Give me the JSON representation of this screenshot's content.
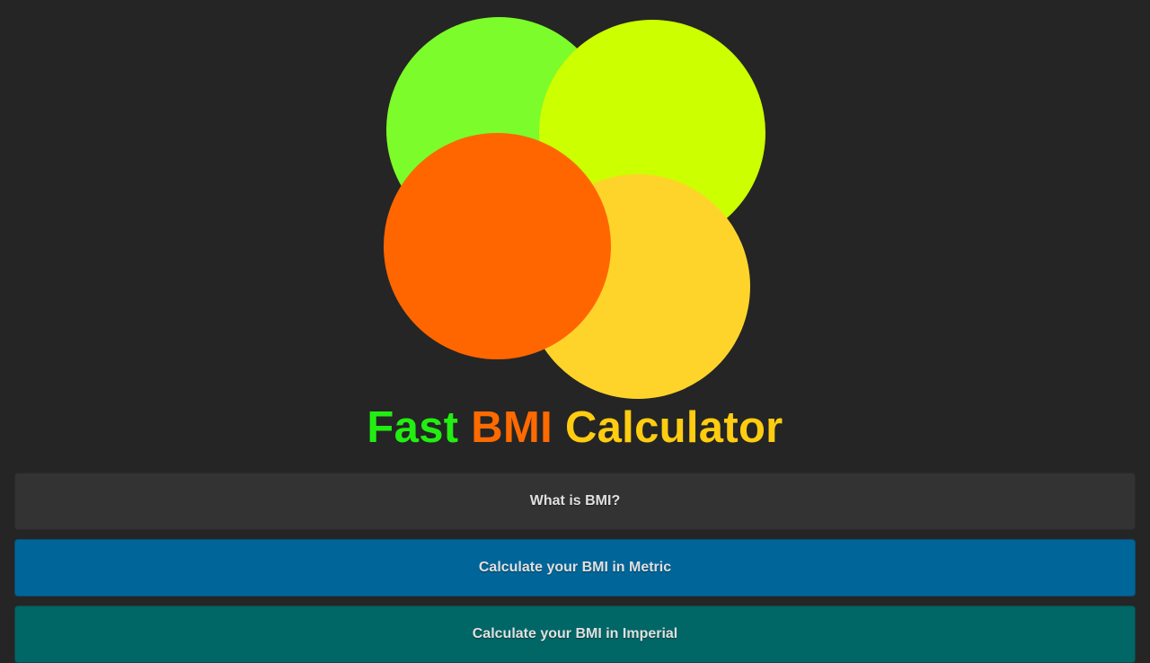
{
  "logo": {
    "colors": {
      "green": "#7cfc2a",
      "lime": "#ccff00",
      "yellow": "#ffd42a",
      "orange": "#ff6600"
    }
  },
  "title": {
    "word1": "Fast",
    "word2": "BMI",
    "word3": "Calculator",
    "colors": {
      "word1": "#22ee11",
      "word2": "#ff6a00",
      "word3": "#ffcc11"
    }
  },
  "menu": {
    "what_is_bmi": {
      "label": "What is BMI?",
      "color": "#333333"
    },
    "metric": {
      "label": "Calculate your BMI in Metric",
      "color": "#006699"
    },
    "imperial": {
      "label": "Calculate your BMI in Imperial",
      "color": "#006666"
    }
  }
}
